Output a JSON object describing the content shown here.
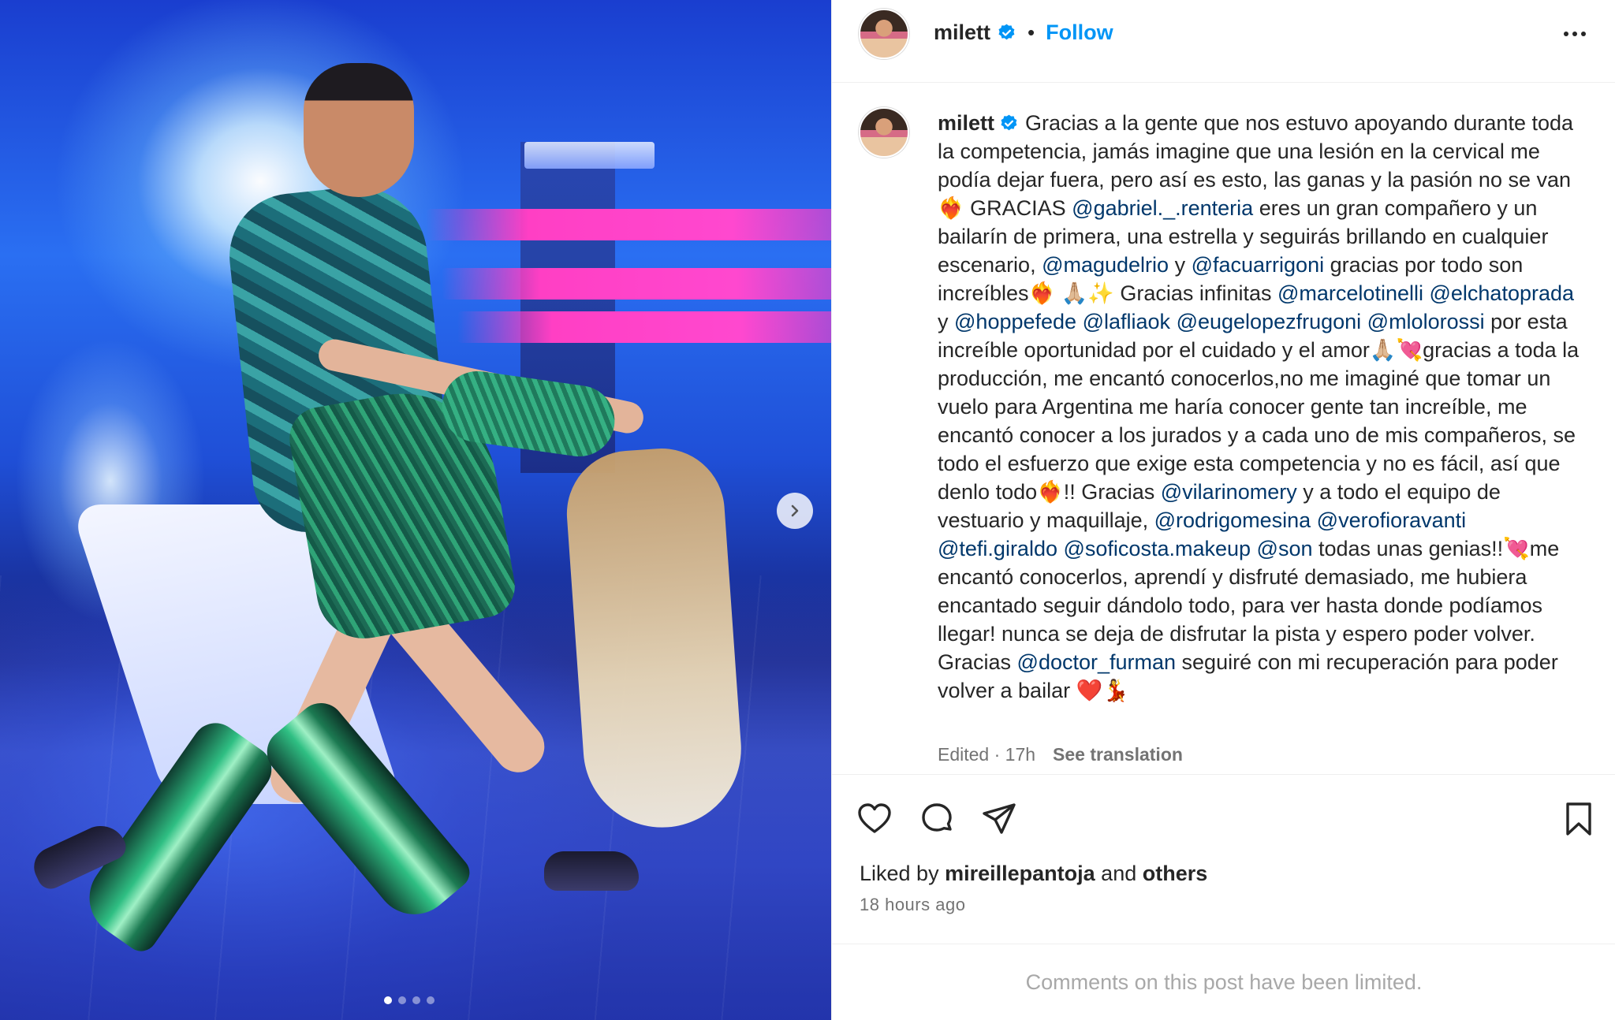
{
  "post": {
    "username": "milett",
    "follow_label": "Follow",
    "separator": "•",
    "caption_username": "milett",
    "caption_segments": [
      {
        "t": "text",
        "v": "Gracias a la gente que nos estuvo apoyando durante toda la competencia, jamás imagine que una lesión en la cervical me podía dejar fuera, pero así es esto, las ganas y la pasión no se van❤️‍🔥 GRACIAS "
      },
      {
        "t": "mention",
        "v": "@gabriel._.renteria"
      },
      {
        "t": "text",
        "v": " eres un gran compañero y un bailarín de primera, una estrella y seguirás brillando en cualquier escenario, "
      },
      {
        "t": "mention",
        "v": "@magudelrio"
      },
      {
        "t": "text",
        "v": " y "
      },
      {
        "t": "mention",
        "v": "@facuarrigoni"
      },
      {
        "t": "text",
        "v": " gracias por todo son increíbles❤️‍🔥 🙏🏼✨ Gracias infinitas "
      },
      {
        "t": "mention",
        "v": "@marcelotinelli"
      },
      {
        "t": "text",
        "v": " "
      },
      {
        "t": "mention",
        "v": "@elchatoprada"
      },
      {
        "t": "text",
        "v": " y "
      },
      {
        "t": "mention",
        "v": "@hoppefede"
      },
      {
        "t": "text",
        "v": " "
      },
      {
        "t": "mention",
        "v": "@lafliaok"
      },
      {
        "t": "text",
        "v": " "
      },
      {
        "t": "mention",
        "v": "@eugelopezfrugoni"
      },
      {
        "t": "text",
        "v": " "
      },
      {
        "t": "mention",
        "v": "@mlolorossi"
      },
      {
        "t": "text",
        "v": " por esta increíble oportunidad por el cuidado y el amor🙏🏼💘gracias a toda la producción, me encantó conocerlos,no me imaginé que tomar un vuelo para Argentina me haría conocer gente tan increíble, me encantó conocer a los jurados y a cada uno de mis compañeros, se todo el esfuerzo que exige esta competencia y no es fácil, así que denlo todo❤️‍🔥!! Gracias "
      },
      {
        "t": "mention",
        "v": "@vilarinomery"
      },
      {
        "t": "text",
        "v": " y a todo el equipo de vestuario y maquillaje, "
      },
      {
        "t": "mention",
        "v": "@rodrigomesina"
      },
      {
        "t": "text",
        "v": " "
      },
      {
        "t": "mention",
        "v": "@verofioravanti"
      },
      {
        "t": "text",
        "v": " "
      },
      {
        "t": "mention",
        "v": "@tefi.giraldo"
      },
      {
        "t": "text",
        "v": " "
      },
      {
        "t": "mention",
        "v": "@soficosta.makeup"
      },
      {
        "t": "text",
        "v": " "
      },
      {
        "t": "mention",
        "v": "@son"
      },
      {
        "t": "text",
        "v": " todas unas genias!!💘me encantó conocerlos, aprendí y disfruté demasiado, me hubiera encantado seguir dándolo todo, para ver hasta donde podíamos llegar! nunca se deja de disfrutar la pista y espero poder volver. Gracias "
      },
      {
        "t": "mention",
        "v": "@doctor_furman"
      },
      {
        "t": "text",
        "v": " seguiré con mi recuperación para poder volver a bailar ❤️💃"
      }
    ],
    "edited_label": "Edited · 17h",
    "see_translation": "See translation",
    "liked_by_prefix": "Liked by",
    "liked_by_user": "mireillepantoja",
    "liked_by_and": "and",
    "liked_by_others": "others",
    "time_ago": "18 hours ago",
    "comments_notice": "Comments on this post have been limited."
  },
  "carousel": {
    "total_slides": 4,
    "active_index": 0
  },
  "icons": {
    "verified": "verified-badge-icon",
    "more": "more-options-icon",
    "next": "chevron-right-icon",
    "like": "heart-icon",
    "comment": "comment-bubble-icon",
    "share": "paper-plane-icon",
    "save": "bookmark-icon"
  },
  "colors": {
    "accent": "#0095f6",
    "mention": "#00376b",
    "secondary_text": "#737373",
    "verified": "#0095f6"
  }
}
